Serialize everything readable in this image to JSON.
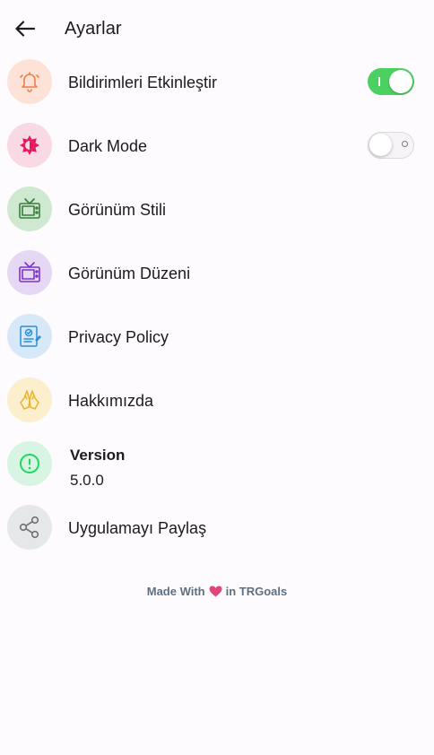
{
  "header": {
    "title": "Ayarlar",
    "back_icon": "arrow-left-icon"
  },
  "settings": {
    "notifications": {
      "label": "Bildirimleri Etkinleştir",
      "icon": "bell-icon",
      "icon_color": "#f27d4a",
      "bg": "#fde3d7",
      "enabled": true
    },
    "dark_mode": {
      "label": "Dark Mode",
      "icon": "sun-icon",
      "icon_color": "#e6195e",
      "bg": "#f9d9e3",
      "enabled": false
    },
    "view_style": {
      "label": "Görünüm Stili",
      "icon": "tv-icon",
      "icon_color": "#3a7d3e",
      "bg": "#cfe8d0"
    },
    "view_layout": {
      "label": "Görünüm Düzeni",
      "icon": "tv-icon",
      "icon_color": "#7b35c9",
      "bg": "#e6d8f4"
    },
    "privacy": {
      "label": "Privacy Policy",
      "icon": "document-icon",
      "icon_color": "#2a8fd8",
      "bg": "#d7e8f8"
    },
    "about": {
      "label": "Hakkımızda",
      "icon": "handshake-icon",
      "icon_color": "#e6b530",
      "bg": "#fcefcd"
    },
    "version": {
      "title": "Version",
      "value": "5.0.0",
      "icon": "alert-circle-icon",
      "icon_color": "#1ed760",
      "bg": "#d8f4e2"
    },
    "share": {
      "label": "Uygulamayı Paylaş",
      "icon": "share-icon",
      "icon_color": "#6b7278",
      "bg": "#e6e7e9"
    }
  },
  "footer": {
    "prefix": "Made With",
    "suffix": "in TRGoals",
    "heart_color": "#e0457b"
  },
  "colors": {
    "toggle_on": "#4cd061",
    "background": "#fdfbfe"
  }
}
